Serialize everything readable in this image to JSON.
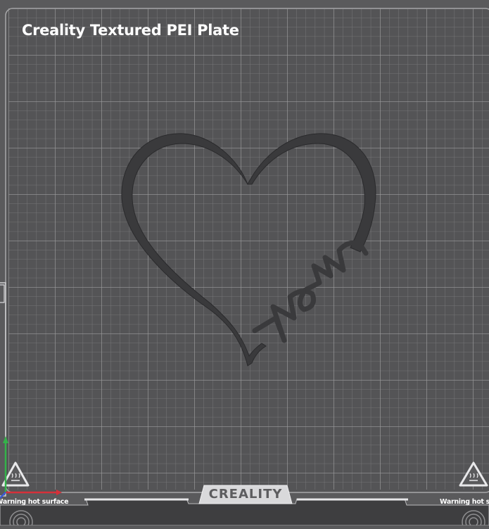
{
  "plate": {
    "title": "Creality Textured PEI Plate",
    "brand": "CREALITY",
    "warning_left": "Warning hot surface",
    "warning_right": "Warning hot surface"
  },
  "model": {
    "text": "mom"
  },
  "icons": {
    "hot_surface": "hot-surface-warning-icon",
    "axes": "axis-gizmo-icon",
    "fan": "fan-vent-icon"
  },
  "colors": {
    "plate_surface": "#545456",
    "grid_line": "#8a8a8c",
    "frame_line": "#a8a8aa",
    "model": "#3a3a3c",
    "title": "#ffffff",
    "axis_x": "#d6303a",
    "axis_y": "#34b24a",
    "axis_z": "#3a5ad6"
  }
}
